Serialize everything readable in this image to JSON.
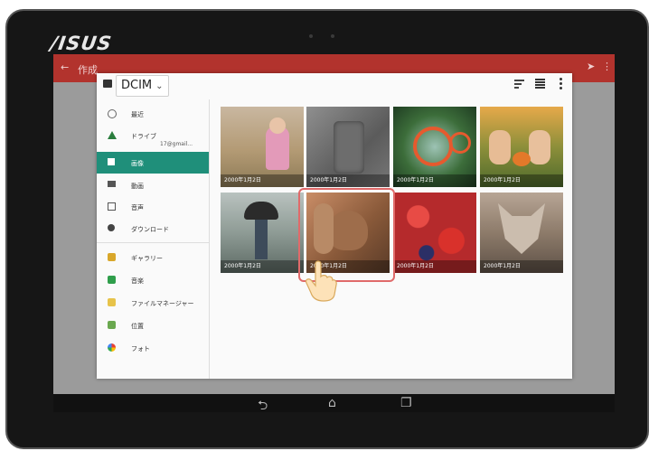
{
  "device": {
    "brand": "/ISUS"
  },
  "app_bar": {
    "back": "←",
    "title": "作成",
    "send": "➤",
    "more": "⋮"
  },
  "picker": {
    "location": "DCIM",
    "sidebar": [
      {
        "label": "最近",
        "icon": "clock-icon"
      },
      {
        "label": "ドライブ",
        "sub": "17@gmail...",
        "icon": "drive-icon"
      },
      {
        "label": "画像",
        "icon": "image-icon",
        "active": true
      },
      {
        "label": "動画",
        "icon": "video-icon"
      },
      {
        "label": "音声",
        "icon": "audio-icon"
      },
      {
        "label": "ダウンロード",
        "icon": "download-icon"
      },
      {
        "label": "ギャラリー",
        "icon": "gallery-app-icon"
      },
      {
        "label": "音楽",
        "icon": "music-app-icon"
      },
      {
        "label": "ファイルマネージャー",
        "icon": "file-manager-icon"
      },
      {
        "label": "位置",
        "icon": "location-icon"
      },
      {
        "label": "フォト",
        "icon": "photos-icon"
      }
    ],
    "photos": [
      {
        "caption": "2000年1月2日",
        "subject": "toddler-in-field"
      },
      {
        "caption": "2000年1月2日",
        "subject": "stone-relief"
      },
      {
        "caption": "2000年1月2日",
        "subject": "orange-bubble"
      },
      {
        "caption": "2000年1月2日",
        "subject": "kids-with-pumpkin"
      },
      {
        "caption": "2000年1月2日",
        "subject": "person-with-umbrella"
      },
      {
        "caption": "2000年1月2日",
        "subject": "squirrel"
      },
      {
        "caption": "2000年1月2日",
        "subject": "strawberries-blueberries"
      },
      {
        "caption": "2000年1月2日",
        "subject": "wolf"
      }
    ]
  },
  "navbar": {
    "back": "⮌",
    "home": "⌂",
    "recents": "❐"
  },
  "colors": {
    "accent": "#1f8f7a",
    "app_bar": "#b2332d",
    "highlight": "#e06a6a"
  }
}
